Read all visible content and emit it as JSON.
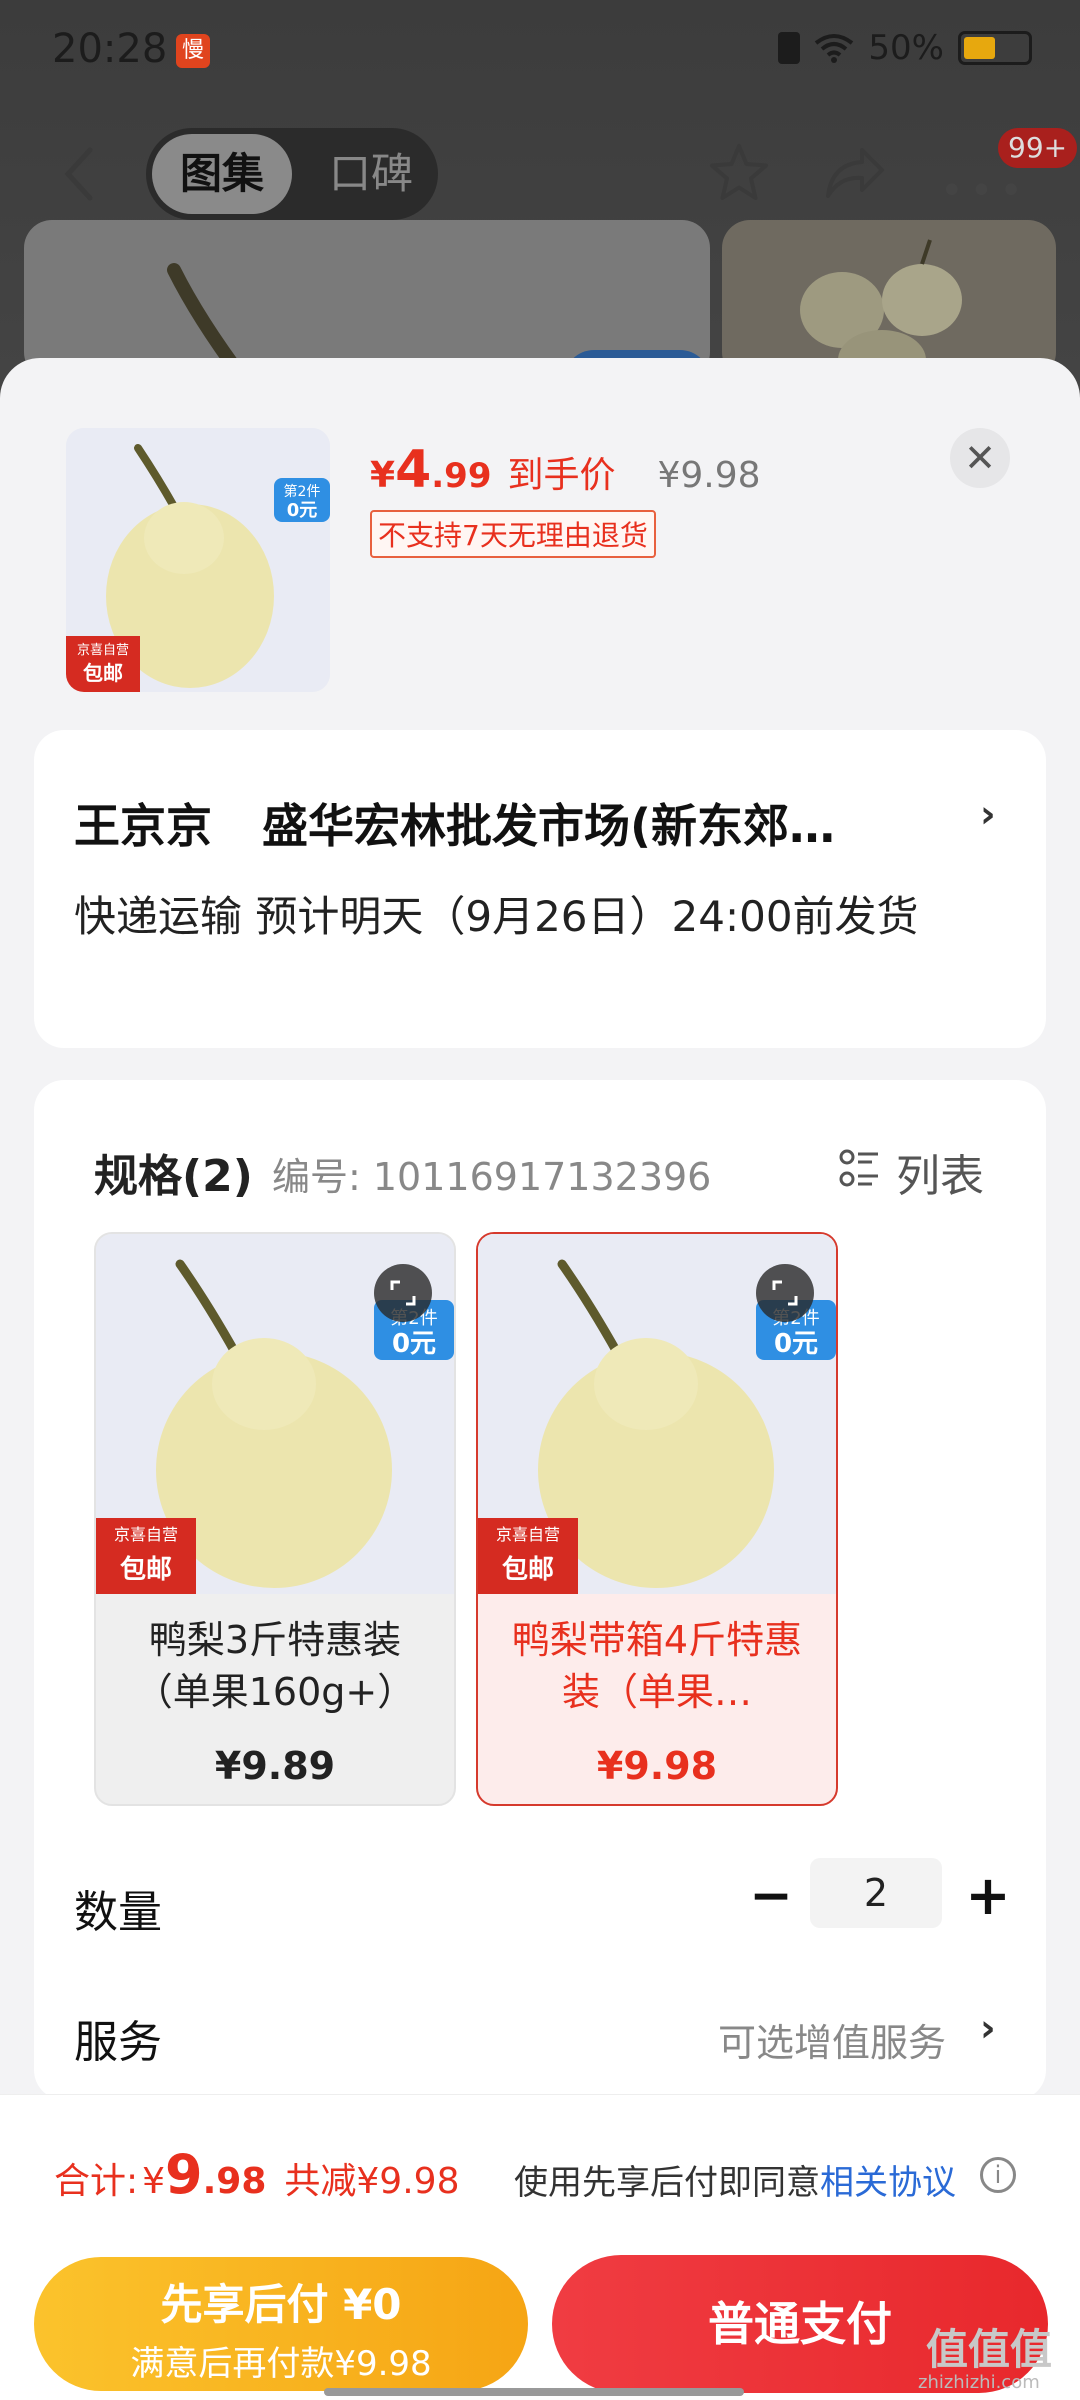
{
  "status_bar": {
    "time": "20:28",
    "app_badge": "慢",
    "battery": "50%"
  },
  "nav": {
    "tab_active": "图集",
    "tab_inactive": "口碑",
    "badge": "99+"
  },
  "product": {
    "price_currency": "¥",
    "price_int": "4",
    "price_dec": ".99",
    "price_label": "到手价",
    "orig_price": "¥9.98",
    "return_tag": "不支持7天无理由退货",
    "thumb_promo_top": "第2件",
    "thumb_promo_bottom": "0元",
    "thumb_badge_top": "京喜自营",
    "thumb_badge_bottom": "包邮"
  },
  "address": {
    "name": "王京京",
    "market": "盛华宏林批发市场(新东郊…",
    "delivery": "快递运输 预计明天（9月26日）24:00前发货"
  },
  "spec": {
    "title": "规格(2)",
    "code": "编号: 10116917132396",
    "list_label": "列表",
    "items": [
      {
        "name": "鸭梨3斤特惠装（单果160g+）",
        "price": "¥9.89",
        "promo_top": "第2件",
        "promo_bottom": "0元",
        "badge_top": "京喜自营",
        "badge_bottom": "包邮"
      },
      {
        "name": "鸭梨带箱4斤特惠装（单果…",
        "price": "¥9.98",
        "promo_top": "第2件",
        "promo_bottom": "0元",
        "badge_top": "京喜自营",
        "badge_bottom": "包邮"
      }
    ],
    "selected_index": 1
  },
  "quantity": {
    "label": "数量",
    "value": "2",
    "minus": "−",
    "plus": "+"
  },
  "service": {
    "label": "服务",
    "hint": "可选增值服务"
  },
  "footer": {
    "total_label": "合计:",
    "total_cur": "¥",
    "total_int": "9",
    "total_dec": ".98",
    "discount": "共减¥9.98",
    "agree_text": "使用先享后付即同意",
    "agree_link": "相关协议",
    "pay_later_title": "先享后付 ¥0",
    "pay_later_sub": "满意后再付款¥9.98",
    "pay_normal": "普通支付"
  },
  "watermark": {
    "main": "值值值",
    "sub": "zhizhizhi.com"
  },
  "colors": {
    "accent_red": "#e8301e",
    "pay_later_yellow": "#f8b41f",
    "pay_normal_red": "#ec3035",
    "link_blue": "#2a6ad6"
  }
}
